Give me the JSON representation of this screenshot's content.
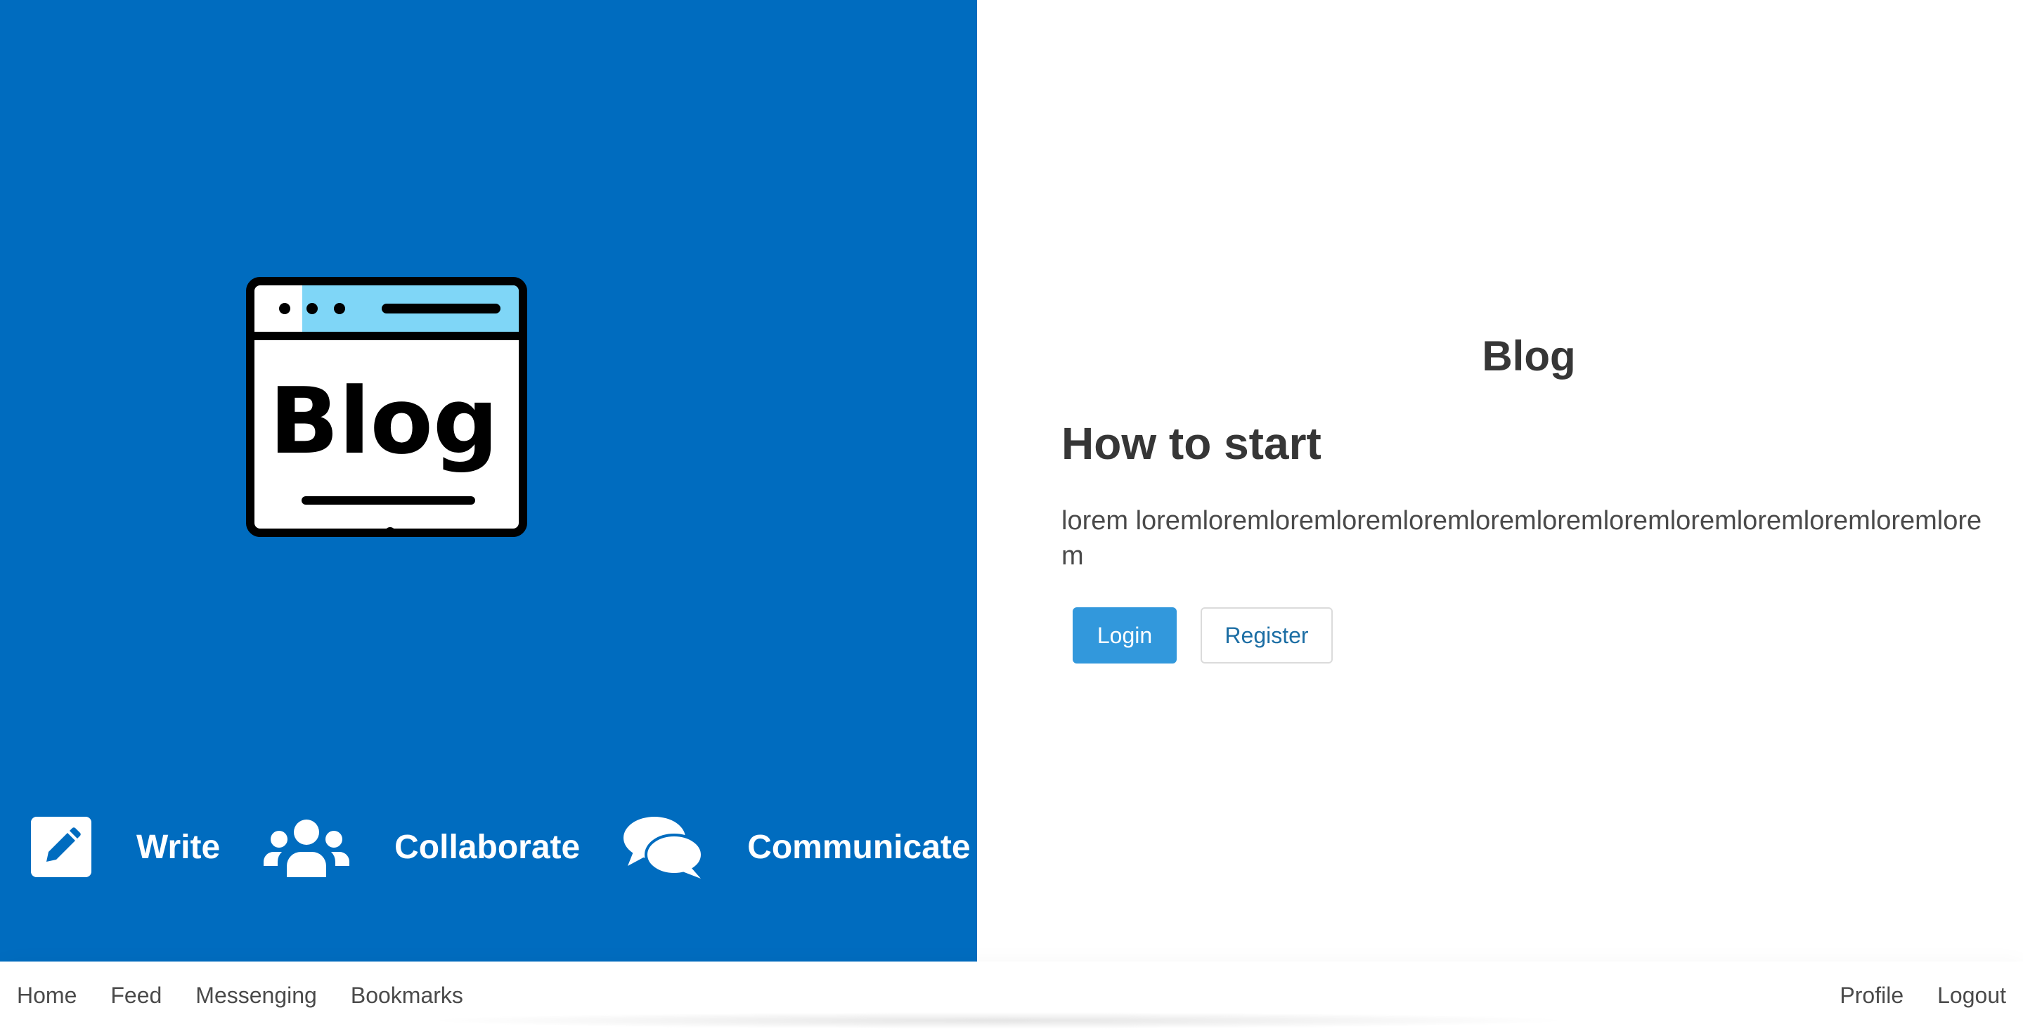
{
  "hero": {
    "illustration_text": "Blog",
    "features": [
      {
        "icon": "edit-icon",
        "label": "Write"
      },
      {
        "icon": "users-icon",
        "label": "Collaborate"
      },
      {
        "icon": "comments-icon",
        "label": "Communicate"
      }
    ]
  },
  "main": {
    "site_title": "Blog",
    "section_title": "How to start",
    "section_text": "lorem loremloremloremloremloremloremloremloremloremloremloremloremlorem",
    "login_label": "Login",
    "register_label": "Register"
  },
  "nav": {
    "left": [
      "Home",
      "Feed",
      "Messenging",
      "Bookmarks"
    ],
    "right": [
      "Profile",
      "Logout"
    ]
  },
  "colors": {
    "hero_bg": "#006cbf",
    "primary_button": "#3298dc",
    "link": "#1c6ea4"
  }
}
